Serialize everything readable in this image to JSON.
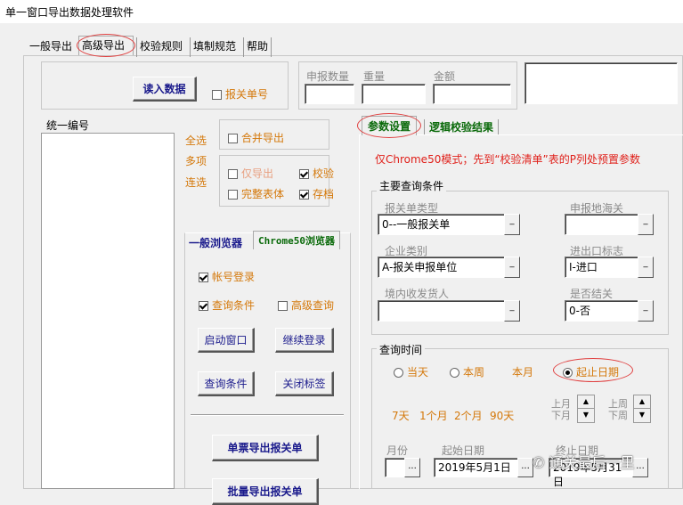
{
  "window": {
    "title": "单一窗口导出数据处理软件"
  },
  "menu_tabs": [
    "一般导出",
    "高级导出",
    "校验规则",
    "填制规范",
    "帮助"
  ],
  "read_button": "读入数据",
  "customs_label": "报关单号",
  "stats": {
    "count_label": "申报数量",
    "weight_label": "重量",
    "amount_label": "金额"
  },
  "left": {
    "list_header": "统一编号",
    "select_all": "全选",
    "multi": "多项",
    "continuous": "连选",
    "merge_export": "合并导出",
    "only_export": "仅导出",
    "validate": "校验",
    "full_header": "完整表体",
    "archive": "存档"
  },
  "browser_tabs": [
    "一般浏览器",
    "Chrome50浏览器"
  ],
  "browser": {
    "account_login": "帐号登录",
    "query_cond_chk": "查询条件",
    "advanced_query": "高级查询",
    "start_window": "启动窗口",
    "continue_login": "继续登录",
    "query_cond_btn": "查询条件",
    "close_tab": "关闭标签",
    "single_export": "单票导出报关单",
    "batch_export": "批量导出报关单"
  },
  "right_tabs": [
    "参数设置",
    "逻辑校验结果"
  ],
  "notice": "仅Chrome50模式；先到“校验清单”表的P列处预置参数",
  "main_query": {
    "title": "主要查询条件",
    "decl_type_label": "报关单类型",
    "decl_type_value": "0--一般报关单",
    "decl_customs_label": "申报地海关",
    "decl_customs_value": "",
    "company_type_label": "企业类别",
    "company_type_value": "A-报关申报单位",
    "ie_flag_label": "进出口标志",
    "ie_flag_value": "I-进口",
    "consignee_label": "境内收发货人",
    "consignee_value": "",
    "closed_label": "是否结关",
    "closed_value": "0-否"
  },
  "query_time": {
    "title": "查询时间",
    "today": "当天",
    "this_week": "本周",
    "this_month": "本月",
    "date_range": "起止日期",
    "d7": "7天",
    "m1": "1个月",
    "m2": "2个月",
    "d90": "90天",
    "prev_month": "上月\n下月",
    "prev_week": "上周\n下周",
    "month_label": "月份",
    "start_label": "起始日期",
    "start_value": "2019年5月1日",
    "end_label": "终止日期",
    "end_value": "2019年5月31日"
  },
  "ellipsis": "...",
  "dd": "_",
  "watermark": "通关最后一里"
}
